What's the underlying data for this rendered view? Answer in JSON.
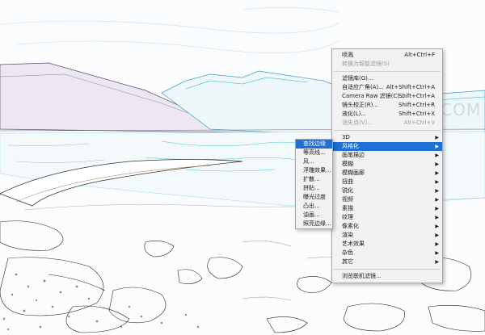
{
  "watermark": "三联 3LIAN.COM",
  "filter_menu": {
    "items": [
      {
        "label": "喷溅",
        "shortcut": "Alt+Ctrl+F",
        "disabled": false
      },
      {
        "label": "转换为智能滤镜(S)",
        "shortcut": "",
        "disabled": true
      },
      {
        "separator": true
      },
      {
        "label": "滤镜库(G)...",
        "shortcut": "",
        "disabled": false
      },
      {
        "label": "自适应广角(A)...",
        "shortcut": "Alt+Shift+Ctrl+A",
        "disabled": false
      },
      {
        "label": "Camera Raw 滤镜(C)...",
        "shortcut": "Shift+Ctrl+A",
        "disabled": false
      },
      {
        "label": "镜头校正(R)...",
        "shortcut": "Shift+Ctrl+R",
        "disabled": false
      },
      {
        "label": "液化(L)...",
        "shortcut": "Shift+Ctrl+X",
        "disabled": false
      },
      {
        "label": "消失点(V)...",
        "shortcut": "Alt+Ctrl+V",
        "disabled": true
      },
      {
        "separator": true
      },
      {
        "label": "3D",
        "submenu": true
      },
      {
        "label": "风格化",
        "submenu": true,
        "highlighted": true
      },
      {
        "label": "画笔描边",
        "submenu": true
      },
      {
        "label": "模糊",
        "submenu": true
      },
      {
        "label": "模糊画廊",
        "submenu": true
      },
      {
        "label": "扭曲",
        "submenu": true
      },
      {
        "label": "锐化",
        "submenu": true
      },
      {
        "label": "视频",
        "submenu": true
      },
      {
        "label": "素描",
        "submenu": true
      },
      {
        "label": "纹理",
        "submenu": true
      },
      {
        "label": "像素化",
        "submenu": true
      },
      {
        "label": "渲染",
        "submenu": true
      },
      {
        "label": "艺术效果",
        "submenu": true
      },
      {
        "label": "杂色",
        "submenu": true
      },
      {
        "label": "其它",
        "submenu": true
      },
      {
        "separator": true
      },
      {
        "label": "浏览联机滤镜..."
      }
    ]
  },
  "stylize_submenu": {
    "items": [
      {
        "label": "查找边缘",
        "highlighted": true
      },
      {
        "label": "等高线..."
      },
      {
        "label": "风..."
      },
      {
        "label": "浮雕效果..."
      },
      {
        "label": "扩散..."
      },
      {
        "label": "拼贴..."
      },
      {
        "label": "曝光过度"
      },
      {
        "label": "凸出..."
      },
      {
        "label": "油画..."
      },
      {
        "label": "照亮边缘..."
      }
    ]
  }
}
